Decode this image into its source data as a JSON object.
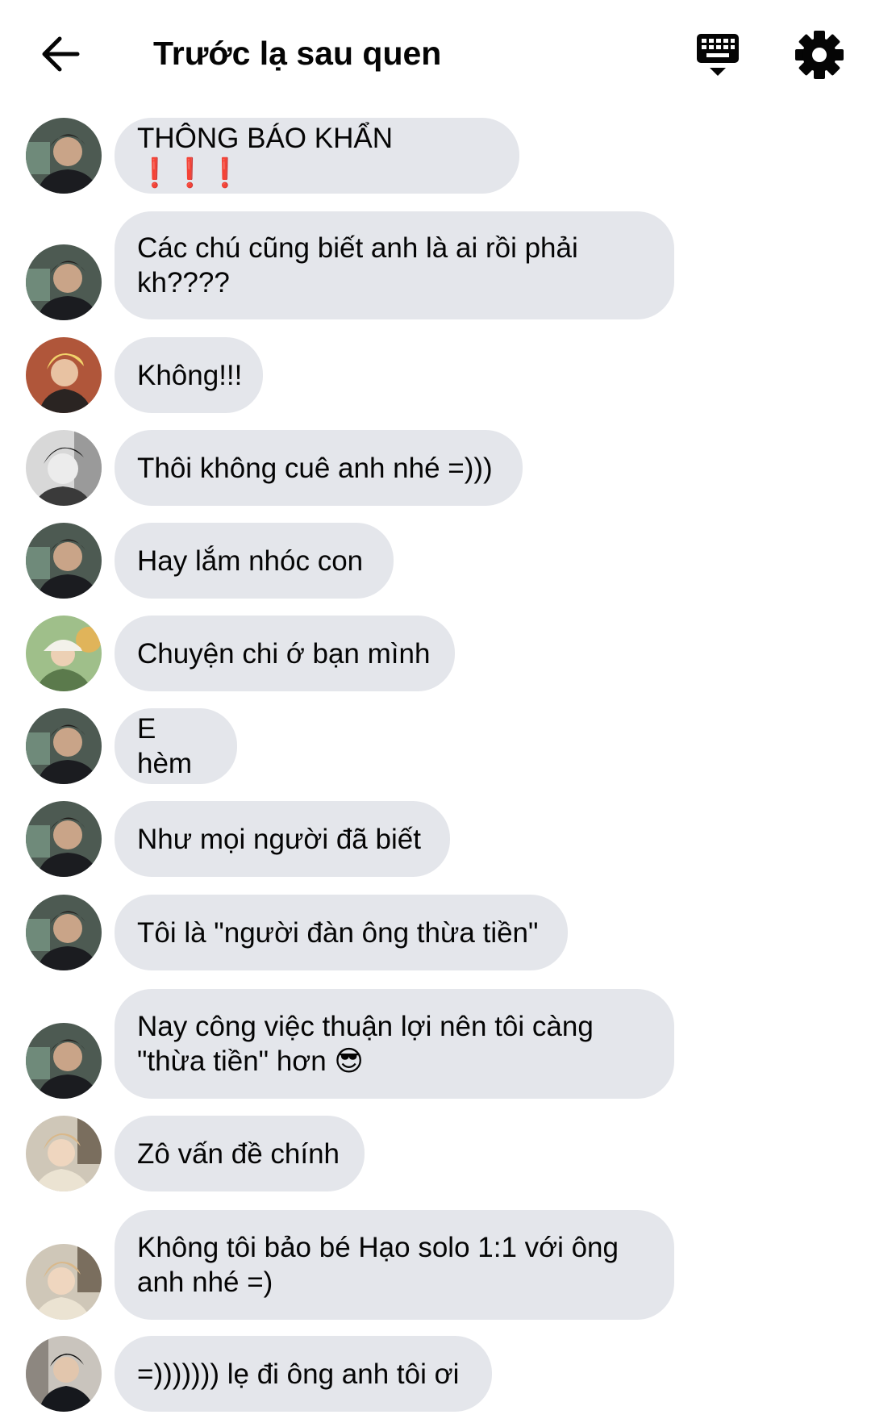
{
  "header": {
    "title": "Trước lạ sau quen",
    "back_icon": "arrow-left-icon",
    "keyboard_icon": "keyboard-icon",
    "settings_icon": "gear-icon"
  },
  "messages": [
    {
      "avatar": "man-dark-hair",
      "text": "THÔNG BÁO KHẨN ❗❗❗"
    },
    {
      "avatar": "man-dark-hair",
      "text": "Các chú cũng biết anh là ai rồi phải kh????"
    },
    {
      "avatar": "man-blonde-hair",
      "text": "Không!!!"
    },
    {
      "avatar": "man-black-white-photo",
      "text": "Thôi không cuê anh nhé =)))"
    },
    {
      "avatar": "man-dark-hair",
      "text": "Hay lắm nhóc con"
    },
    {
      "avatar": "man-bucket-hat-outdoor",
      "text": "Chuyện chi ớ bạn mình"
    },
    {
      "avatar": "man-dark-hair",
      "text": "E hèm"
    },
    {
      "avatar": "man-dark-hair",
      "text": "Như mọi người đã biết"
    },
    {
      "avatar": "man-dark-hair",
      "text": "Tôi là \"người đàn ông thừa tiền\""
    },
    {
      "avatar": "man-dark-hair",
      "text": "Nay công việc thuận lợi nên tôi càng \"thừa tiền\" hơn 😎"
    },
    {
      "avatar": "man-light-hair-window",
      "text": "Zô vấn đề chính"
    },
    {
      "avatar": "man-light-hair-window",
      "text": "Không tôi bảo bé Hạo solo 1:1 với ông anh nhé =)"
    },
    {
      "avatar": "man-dark-portrait",
      "text": "=))))))) lẹ đi ông anh tôi ơi"
    }
  ]
}
